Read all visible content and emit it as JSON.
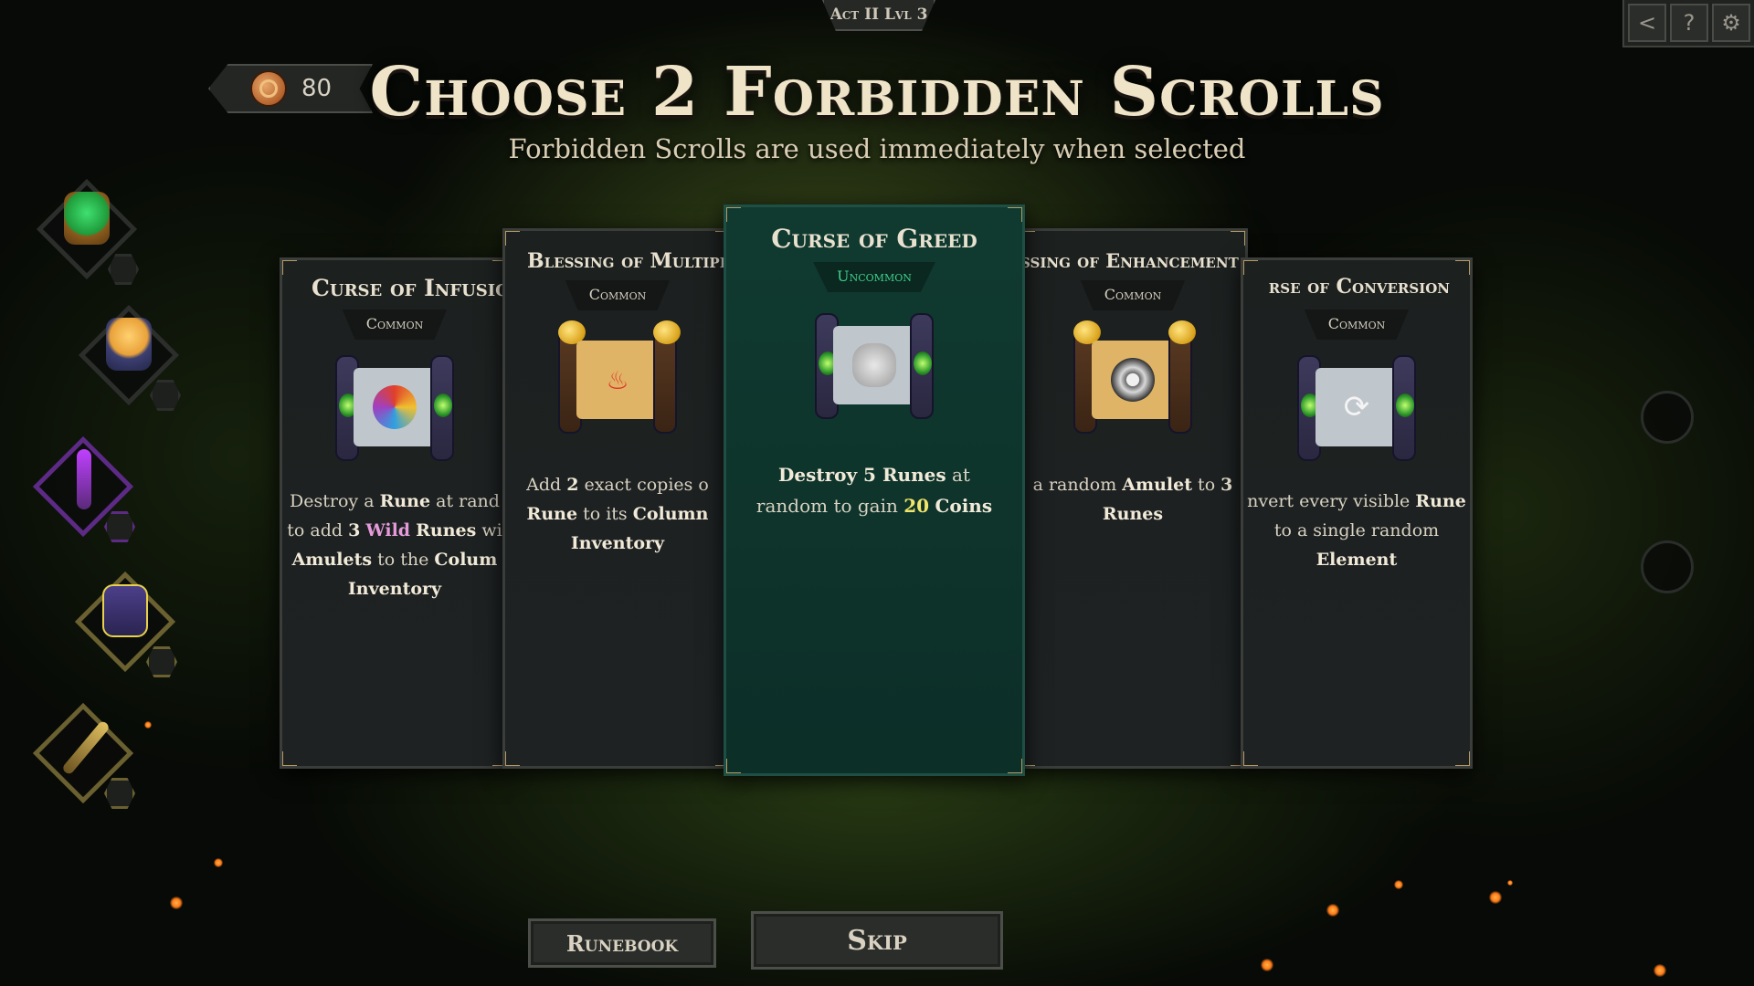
{
  "header": {
    "act_label": "Act II Lvl 3",
    "title": "Choose 2 Forbidden Scrolls",
    "subtitle": "Forbidden Scrolls are used immediately when selected"
  },
  "coins": {
    "count": "80"
  },
  "top_buttons": [
    {
      "icon": "share-icon",
      "glyph": "<"
    },
    {
      "icon": "help-icon",
      "glyph": "?"
    },
    {
      "icon": "gear-icon",
      "glyph": "⚙"
    }
  ],
  "relics": [
    {
      "icon": "green-gem-ring-icon",
      "color": "#1f9a3a"
    },
    {
      "icon": "orange-rune-ring-icon",
      "color": "#e9a23a"
    },
    {
      "icon": "purple-staff-icon",
      "color": "#8a3dbb"
    },
    {
      "icon": "lightning-totem-icon",
      "color": "#5a4c9a"
    },
    {
      "icon": "golden-wand-icon",
      "color": "#b39a4a"
    }
  ],
  "cards": [
    {
      "name": "Curse of Infusio",
      "rarity": "Common",
      "icon": "swirl-scroll-icon",
      "lines": [
        [
          {
            "t": "Destroy a "
          },
          {
            "t": "Rune",
            "b": true
          },
          {
            "t": " at rand"
          }
        ],
        [
          {
            "t": "to add "
          },
          {
            "t": "3",
            "b": true
          },
          {
            "t": " "
          },
          {
            "t": "Wild",
            "c": "pink"
          },
          {
            "t": " "
          },
          {
            "t": "Runes",
            "b": true
          },
          {
            "t": " wi"
          }
        ],
        [
          {
            "t": "Amulets",
            "b": true
          },
          {
            "t": " to the "
          },
          {
            "t": "Colum",
            "b": true
          }
        ],
        [
          {
            "t": "Inventory",
            "b": true
          }
        ]
      ]
    },
    {
      "name": "Blessing of Multipli",
      "rarity": "Common",
      "icon": "flame-scroll-icon",
      "lines": [
        [
          {
            "t": "Add "
          },
          {
            "t": "2",
            "b": true
          },
          {
            "t": " exact copies o"
          }
        ],
        [
          {
            "t": "Rune",
            "b": true
          },
          {
            "t": " to its "
          },
          {
            "t": "Column",
            "b": true
          }
        ],
        [
          {
            "t": "Inventory",
            "b": true
          }
        ]
      ]
    },
    {
      "name": "Curse of Greed",
      "rarity": "Uncommon",
      "icon": "coins-scroll-icon",
      "lines": [
        [
          {
            "t": "Destroy 5 Runes",
            "b": true
          },
          {
            "t": " at"
          }
        ],
        [
          {
            "t": "random to gain "
          },
          {
            "t": "20",
            "c": "yellow"
          },
          {
            "t": " "
          },
          {
            "t": "Coins",
            "b": true
          }
        ]
      ]
    },
    {
      "name": "ssing of Enhancement",
      "rarity": "Common",
      "icon": "amulet-scroll-icon",
      "lines": [
        [
          {
            "t": "a random "
          },
          {
            "t": "Amulet",
            "b": true
          },
          {
            "t": " to "
          },
          {
            "t": "3",
            "b": true
          }
        ],
        [
          {
            "t": "Runes",
            "b": true
          }
        ]
      ]
    },
    {
      "name": "rse of Conversion",
      "rarity": "Common",
      "icon": "convert-scroll-icon",
      "lines": [
        [
          {
            "t": "nvert every visible "
          },
          {
            "t": "Rune",
            "b": true
          }
        ],
        [
          {
            "t": "to a single random"
          }
        ],
        [
          {
            "t": "Element",
            "b": true
          }
        ]
      ]
    }
  ],
  "buttons": {
    "runebook": "Runebook",
    "skip": "Skip"
  },
  "colors": {
    "accent_gold": "#b59a63",
    "selected_card": "#123a30",
    "uncommon": "#3fd08a"
  }
}
